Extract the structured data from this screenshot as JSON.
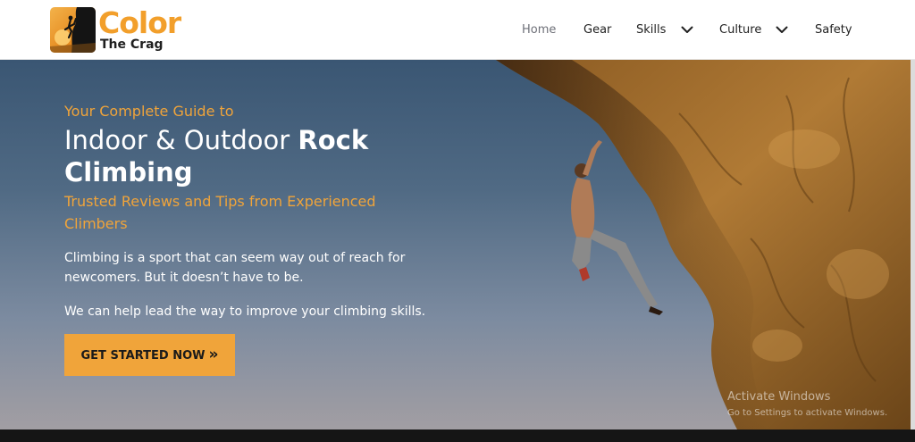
{
  "brand": {
    "name_line1": "Color",
    "name_line2": "The Crag",
    "accent_color": "#f0a43a"
  },
  "nav": {
    "items": [
      {
        "label": "Home",
        "active": true,
        "has_dropdown": false
      },
      {
        "label": "Gear",
        "active": false,
        "has_dropdown": false
      },
      {
        "label": "Skills",
        "active": false,
        "has_dropdown": true
      },
      {
        "label": "Culture",
        "active": false,
        "has_dropdown": true
      },
      {
        "label": "Safety",
        "active": false,
        "has_dropdown": false
      }
    ]
  },
  "hero": {
    "eyebrow": "Your Complete Guide to",
    "headline_regular": "Indoor & Outdoor ",
    "headline_bold": "Rock Climbing",
    "subheadline": "Trusted Reviews and Tips from Experienced Climbers",
    "paragraph1": "Climbing is a sport that can seem way out of reach for newcomers. But it doesn’t have to be.",
    "paragraph2": "We can help lead the way to improve your climbing skills.",
    "cta_label": "GET STARTED NOW",
    "cta_icon": "double-chevron-right-icon"
  },
  "watermark": {
    "line1": "Activate Windows",
    "line2": "Go to Settings to activate Windows."
  }
}
